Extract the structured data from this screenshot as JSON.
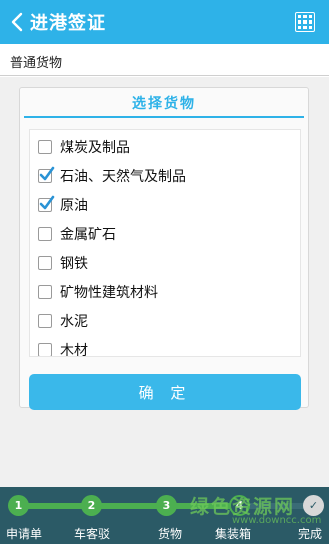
{
  "header": {
    "title": "进港签证",
    "back_icon": "chevron-left-icon",
    "menu_icon": "grid-menu-icon",
    "accent_color": "#2eb2e8"
  },
  "category": {
    "label": "普通货物"
  },
  "dialog": {
    "title": "选择货物",
    "items": [
      {
        "label": "煤炭及制品",
        "checked": false
      },
      {
        "label": "石油、天然气及制品",
        "checked": true
      },
      {
        "label": "原油",
        "checked": true
      },
      {
        "label": "金属矿石",
        "checked": false
      },
      {
        "label": "钢铁",
        "checked": false
      },
      {
        "label": "矿物性建筑材料",
        "checked": false
      },
      {
        "label": "水泥",
        "checked": false
      },
      {
        "label": "木材",
        "checked": false
      }
    ],
    "confirm_label": "确 定"
  },
  "steps": [
    {
      "number": "1",
      "label": "申请单",
      "state": "complete"
    },
    {
      "number": "2",
      "label": "车客驳",
      "state": "complete"
    },
    {
      "number": "3",
      "label": "货物",
      "state": "current"
    },
    {
      "number": "4",
      "label": "集装箱",
      "state": "pending"
    },
    {
      "number": "✓",
      "label": "完成",
      "state": "pending"
    }
  ],
  "watermark": {
    "text": "绿色资源网",
    "sub": "www.downcc.com"
  }
}
